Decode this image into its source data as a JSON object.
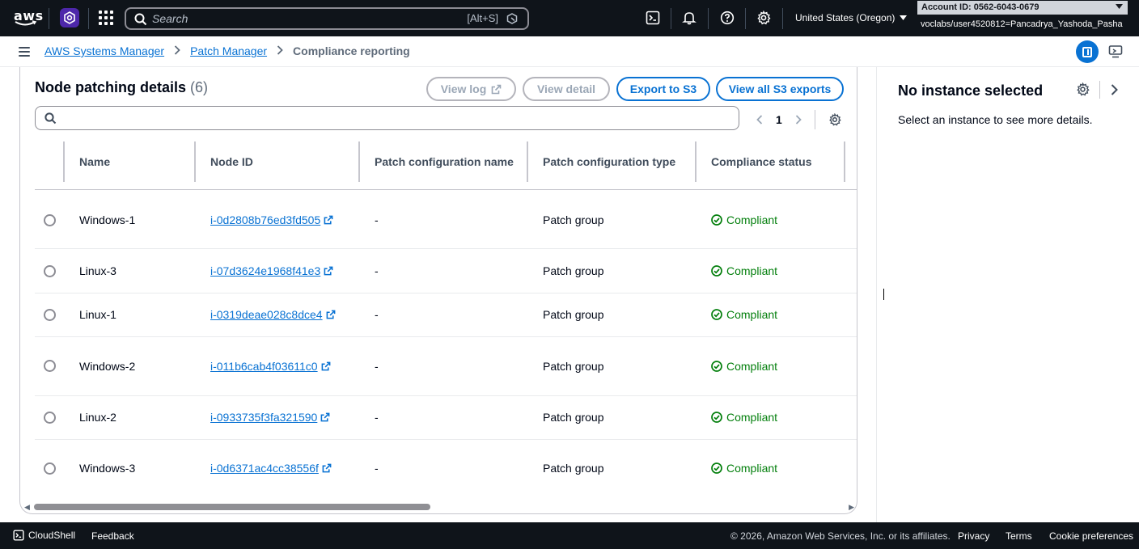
{
  "topnav": {
    "logo_text": "aws",
    "search": {
      "placeholder": "Search",
      "shortcut": "[Alt+S]"
    },
    "icons": [
      "cloudshell-icon",
      "bell-icon",
      "help-icon",
      "gear-icon"
    ],
    "region": "United States (Oregon)",
    "account_id": "Account ID: 0562-6043-0679",
    "user": "voclabs/user4520812=Pancadrya_Yashoda_Pasha"
  },
  "breadcrumb": {
    "items": [
      "AWS Systems Manager",
      "Patch Manager"
    ],
    "current": "Compliance reporting"
  },
  "main": {
    "title": "Node patching details",
    "count": "(6)",
    "buttons": {
      "view_log": "View log",
      "view_detail": "View detail",
      "export": "Export to S3",
      "view_exports": "View all S3 exports"
    },
    "filter_placeholder": "",
    "page": "1",
    "columns": [
      "Name",
      "Node ID",
      "Patch configuration name",
      "Patch configuration type",
      "Compliance status"
    ],
    "rows": [
      {
        "name": "Windows-1",
        "node_id": "i-0d2808b76ed3fd505",
        "config_name": "-",
        "config_type": "Patch group",
        "status": "Compliant"
      },
      {
        "name": "Linux-3",
        "node_id": "i-07d3624e1968f41e3",
        "config_name": "-",
        "config_type": "Patch group",
        "status": "Compliant"
      },
      {
        "name": "Linux-1",
        "node_id": "i-0319deae028c8dce4",
        "config_name": "-",
        "config_type": "Patch group",
        "status": "Compliant"
      },
      {
        "name": "Windows-2",
        "node_id": "i-011b6cab4f03611c0",
        "config_name": "-",
        "config_type": "Patch group",
        "status": "Compliant"
      },
      {
        "name": "Linux-2",
        "node_id": "i-0933735f3fa321590",
        "config_name": "-",
        "config_type": "Patch group",
        "status": "Compliant"
      },
      {
        "name": "Windows-3",
        "node_id": "i-0d6371ac4cc38556f",
        "config_name": "-",
        "config_type": "Patch group",
        "status": "Compliant"
      }
    ]
  },
  "split_panel": {
    "title": "No instance selected",
    "description": "Select an instance to see more details."
  },
  "footer": {
    "cloudshell": "CloudShell",
    "feedback": "Feedback",
    "copyright": "© 2026, Amazon Web Services, Inc. or its affiliates.",
    "privacy": "Privacy",
    "terms": "Terms",
    "cookies": "Cookie preferences"
  },
  "colors": {
    "nav_bg": "#0f141a",
    "link": "#0972d3",
    "success": "#037f0c",
    "service_icon": "#4d27aa"
  }
}
